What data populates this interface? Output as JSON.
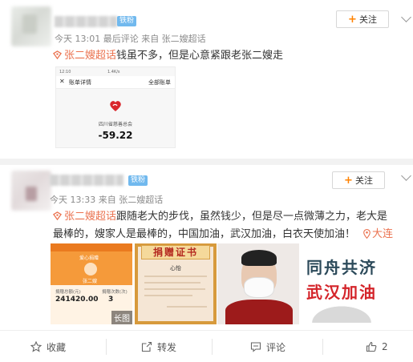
{
  "post1": {
    "badge": "铁粉",
    "follow_label": "关注",
    "meta": "今天 13:01 最后评论 来自 张二嫂超话",
    "topic": "张二嫂超话",
    "text": "钱虽不多，但是心意紧跟老张二嫂走",
    "receipt": {
      "status_time": "12:10",
      "status_right": "1.4K/s",
      "nav_title": "账单详情",
      "nav_right": "全部账单",
      "org": "四川省慈善总会",
      "amount": "-59.22"
    }
  },
  "post2": {
    "badge": "铁粉",
    "follow_label": "关注",
    "meta": "今天 13:33 来自 张二嫂超话",
    "topic": "张二嫂超话",
    "text": "跟随老大的步伐，虽然钱少，但是尽一点微薄之力，老大是最棒的，嫂家人是最棒的，中国加油，武汉加油，白衣天使加油！",
    "location": "大连",
    "images": {
      "t1": {
        "top_text": "爱心捐赠",
        "sub_text": "张二嫂",
        "stat1_label": "捐赠总额(元)",
        "stat1_value": "241420.00",
        "stat2_label": "捐赠次数(次)",
        "stat2_value": "3",
        "badge": "长图"
      },
      "t2": {
        "banner": "捐赠证书",
        "name": "心怡"
      },
      "t4": {
        "line1": "同舟共济",
        "line2": "武汉加油"
      }
    }
  },
  "actions": {
    "favorite": "收藏",
    "repost": "转发",
    "comment": "评论",
    "like_count": "2"
  },
  "colors": {
    "accent": "#eb7350",
    "follow_plus": "#ff8200",
    "badge": "#71b9ee"
  }
}
